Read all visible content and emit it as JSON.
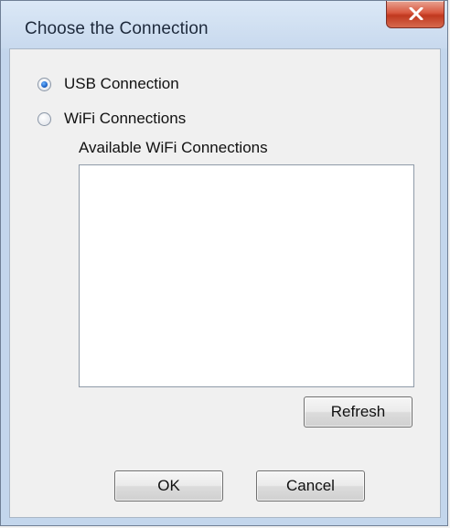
{
  "window": {
    "title": "Choose the Connection"
  },
  "connection": {
    "usb_label": "USB Connection",
    "wifi_label": "WiFi Connections",
    "selected": "usb"
  },
  "wifi_list": {
    "label": "Available WiFi Connections",
    "items": []
  },
  "buttons": {
    "refresh": "Refresh",
    "ok": "OK",
    "cancel": "Cancel"
  }
}
